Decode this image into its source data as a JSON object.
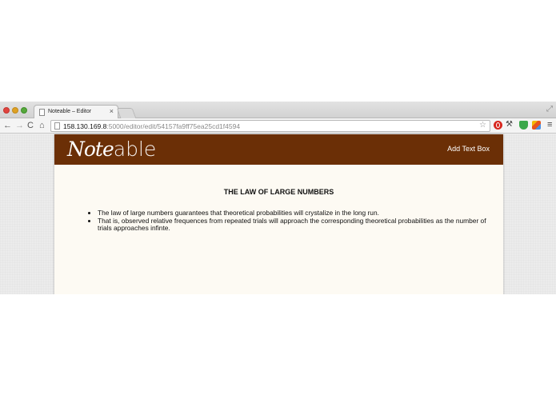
{
  "browser": {
    "tab_title": "Noteable – Editor",
    "tab_close": "×",
    "url_host": "158.130.169.8",
    "url_path": ":5000/editor/edit/54157fa9ff75ea25cd1f4594",
    "icons": {
      "back": "←",
      "forward": "→",
      "reload": "C",
      "home": "⌂",
      "star": "☆",
      "wrench": "⚒",
      "menu": "≡",
      "fullscreen": "⤢"
    }
  },
  "app": {
    "logo_note": "Note",
    "logo_able": "able",
    "add_text_box_label": "Add Text Box",
    "header_color": "#6b2f06"
  },
  "document": {
    "title": "THE LAW OF LARGE NUMBERS",
    "bullets": [
      "The law of large numbers guarantees that theoretical probabilities will crystalize in the long run.",
      "That is, observed relative frequences from repeated trials will approach the corresponding theoretical probabilities as the number of trials approaches infinte."
    ]
  }
}
